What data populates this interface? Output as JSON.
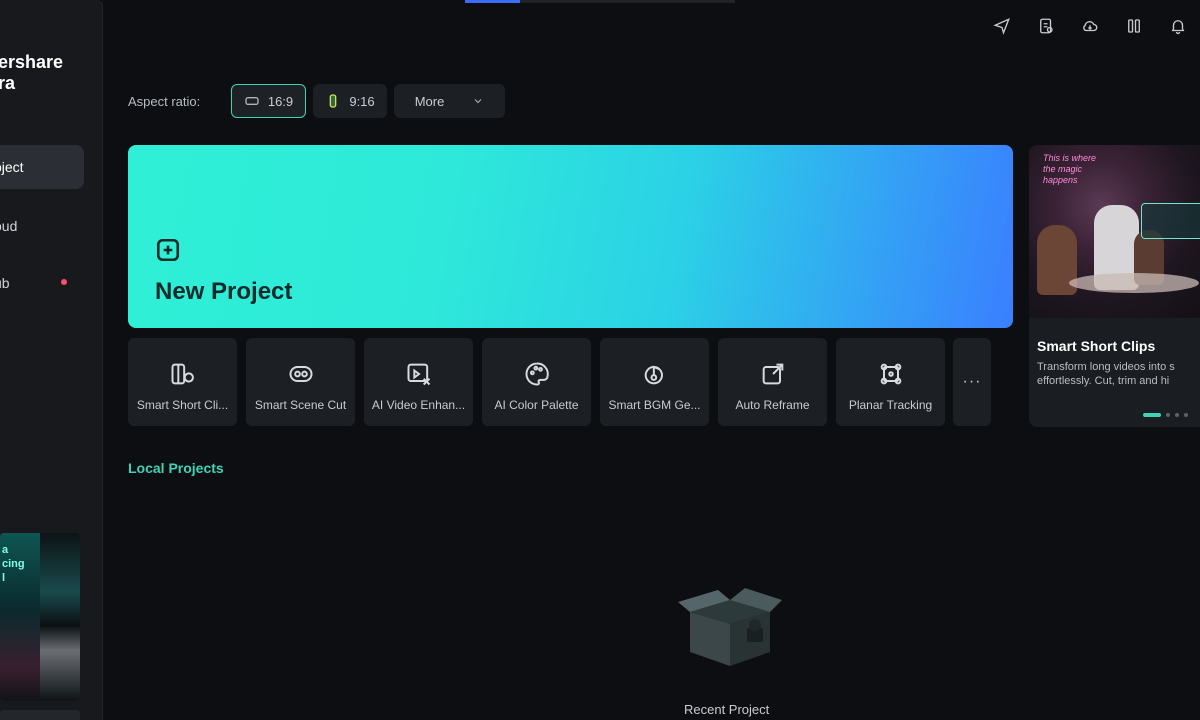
{
  "sidebar": {
    "brand": "ershare\nra",
    "items": [
      {
        "label": "oject",
        "active": true
      },
      {
        "label": "oud",
        "active": false
      },
      {
        "label": "ub",
        "active": false,
        "badge_dot": true
      }
    ],
    "promo_text": "a\ncing\nl"
  },
  "toolbar": {
    "icons": [
      "send-icon",
      "document-icon",
      "cloud-icon",
      "grid-icon",
      "bell-icon"
    ]
  },
  "aspect": {
    "label": "Aspect ratio:",
    "options": [
      {
        "label": "16:9",
        "icon": "landscape-icon",
        "selected": true
      },
      {
        "label": "9:16",
        "icon": "portrait-icon",
        "selected": false
      },
      {
        "label": "More",
        "icon": "chevron-down-icon",
        "selected": false
      }
    ]
  },
  "new_project": {
    "title": "New Project"
  },
  "tools": [
    {
      "label": "Smart Short Cli...",
      "icon": "smart-short-clips-icon"
    },
    {
      "label": "Smart Scene Cut",
      "icon": "smart-scene-cut-icon"
    },
    {
      "label": "AI Video Enhan...",
      "icon": "ai-video-enhancer-icon"
    },
    {
      "label": "AI Color Palette",
      "icon": "ai-color-palette-icon"
    },
    {
      "label": "Smart BGM Ge...",
      "icon": "smart-bgm-icon"
    },
    {
      "label": "Auto Reframe",
      "icon": "auto-reframe-icon"
    },
    {
      "label": "Planar Tracking",
      "icon": "planar-tracking-icon"
    }
  ],
  "more_tools": "···",
  "promo": {
    "neon_text": "This is where\nthe magic\nhappens",
    "title": "Smart Short Clips",
    "description": "Transform long videos into s\neffortlessly. Cut, trim and hi"
  },
  "local_projects": {
    "title": "Local Projects",
    "empty_label": "Recent Project"
  },
  "colors": {
    "accent": "#3fd3b6",
    "background": "#0d0e11",
    "card": "#1c1f24"
  }
}
